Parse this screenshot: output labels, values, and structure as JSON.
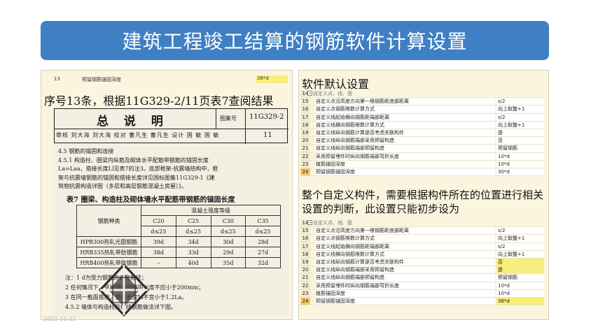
{
  "title": "建筑工程竣工结算的钢筋软件计算设置",
  "date_stamp": "2022-10-22",
  "left": {
    "top_row": {
      "num": "13",
      "name": "预留钢筋锚固深度",
      "value": "38*d"
    },
    "note": "序号13条，根据11G329-2/11页表7查阅结果",
    "doc": {
      "title": "总 说 明",
      "atlas_label": "图集号",
      "atlas_code": "11G329-2",
      "page_label": "页",
      "page_num": "11",
      "sign_row": "审核 刘大海 刘大海 校对 曹凡生 曹凡生 设计 国 敏 国 敏",
      "lines": [
        "4.5 钢筋的锚固和连接",
        "4.5.1 构造柱、圈梁内纵筋及砌体水平配筋带钢筋的锚固长度",
        "La=Laa，搭接长度Ll见表7的注3。底部框架-抗震墙结构中，框",
        "架与抗震墙钢筋的锚固和搭接长度详见国标图集11G329-1《建",
        "筑物抗震构造详图（多层和高层钢筋混凝土房屋）》。"
      ],
      "table_title": "表7 圈梁、构造柱及砌体墙水平配筋带钢筋的锚固长度",
      "table": {
        "group_header": "混凝土强度等级",
        "col0": "钢筋种类",
        "grades": [
          "C20",
          "C25",
          "C30",
          "C35"
        ],
        "sub": "d≤25",
        "rows": [
          {
            "name": "HPB300热轧光圆钢筋",
            "vals": [
              "39d",
              "34d",
              "30d",
              "28d"
            ]
          },
          {
            "name": "HRB335热轧带肋钢筋",
            "vals": [
              "38d",
              "33d",
              "29d",
              "27d"
            ]
          },
          {
            "name": "HRB400热轧带肋钢筋",
            "vals": [
              "–",
              "40d",
              "35d",
              "32d"
            ]
          }
        ]
      },
      "foot": [
        "注：1  d为受力钢筋的公称直径；",
        "2  任何情况下，受拉钢筋的锚固长度不应小于200mm；",
        "3  在同一截面搭接，搭接长度Ll不宜小于1.2La。",
        "4.5.2 墙体与构造柱的拉结钢筋做法详下图。"
      ]
    }
  },
  "right": {
    "heading": "软件默认设置",
    "desc": "整个自定义构件，需要根据构件所在的位置进行相关设置的判断，此设置只能初步设为",
    "group_label": "自定义点、线、面",
    "grid_top": [
      {
        "num": "15",
        "name": "自定义点沿高度方向第一根钢筋距底部距离",
        "value": "s/2",
        "hl": false
      },
      {
        "num": "16",
        "name": "自定义点钢筋根数计算方式",
        "value": "向上取整+1",
        "hl": false
      },
      {
        "num": "17",
        "name": "自定义线起始横向钢筋距端部距离",
        "value": "s/2",
        "hl": false
      },
      {
        "num": "18",
        "name": "自定义线横向钢筋根数计算方式",
        "value": "向上取整+1",
        "hl": false
      },
      {
        "num": "19",
        "name": "自定义线纵向钢筋计算是否考虑关联构件",
        "value": "是",
        "hl": false
      },
      {
        "num": "20",
        "name": "自定义线纵向钢筋端部采用预留构造",
        "value": "否",
        "hl": false
      },
      {
        "num": "21",
        "name": "自定义线纵向钢筋端部预留构造",
        "value": "预留钢筋",
        "hl": false
      },
      {
        "num": "22",
        "name": "采用预留埋件时纵向钢筋端部弯折长度",
        "value": "10*d",
        "hl": false
      },
      {
        "num": "23",
        "name": "植筋锚固深度",
        "value": "10*d",
        "hl": false
      },
      {
        "num": "24",
        "name": "预留钢筋锚固深度",
        "value": "30*d",
        "hl": false
      }
    ],
    "grid_bottom": [
      {
        "num": "15",
        "name": "自定义点沿高度方向第一根钢筋距底部距离",
        "value": "s/2",
        "hl": false
      },
      {
        "num": "16",
        "name": "自定义点钢筋根数计算方式",
        "value": "向上取整+1",
        "hl": false
      },
      {
        "num": "17",
        "name": "自定义线起始横向钢筋距端部距离",
        "value": "s/2",
        "hl": false
      },
      {
        "num": "18",
        "name": "自定义线横向钢筋根数计算方式",
        "value": "向上取整+1",
        "hl": false
      },
      {
        "num": "19",
        "name": "自定义线纵向钢筋计算是否考虑关联构件",
        "value": "否",
        "hl": true
      },
      {
        "num": "20",
        "name": "自定义线纵向钢筋端部采用预留构造",
        "value": "是",
        "hl": true
      },
      {
        "num": "21",
        "name": "自定义线纵向钢筋端部预留构造",
        "value": "预留钢筋",
        "hl": false
      },
      {
        "num": "22",
        "name": "采用预留埋件时纵向钢筋端部弯折长度",
        "value": "10*d",
        "hl": false
      },
      {
        "num": "23",
        "name": "植筋锚固深度",
        "value": "10*d",
        "hl": false
      },
      {
        "num": "24",
        "name": "预留钢筋锚固深度",
        "value": "38*d",
        "hl": true
      }
    ]
  }
}
